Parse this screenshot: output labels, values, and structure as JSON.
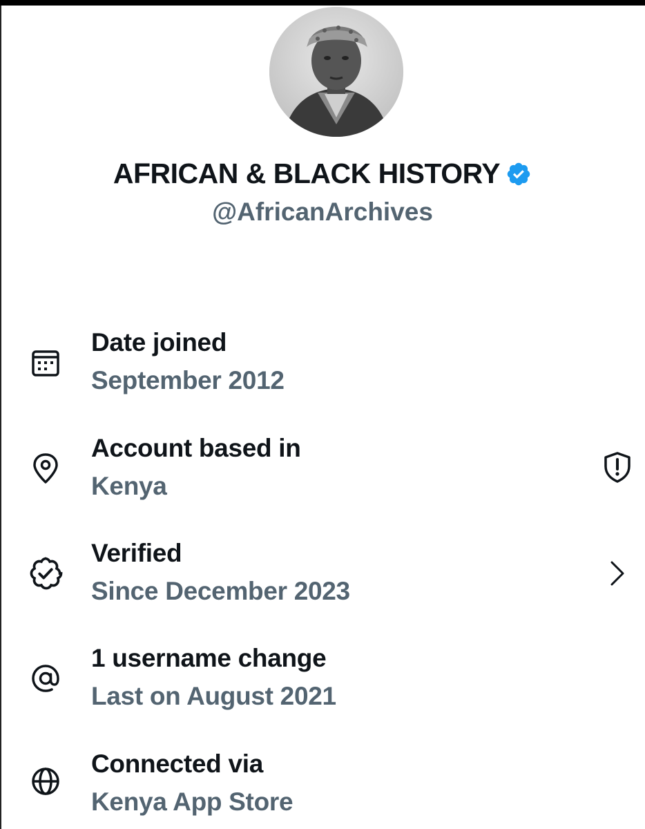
{
  "profile": {
    "display_name": "AFRICAN & BLACK HISTORY",
    "handle": "@AfricanArchives",
    "verified_badge_color": "#1d9bf0",
    "avatar_icon": "profile-photo"
  },
  "about": {
    "items": [
      {
        "icon": "calendar-icon",
        "label": "Date joined",
        "value": "September 2012",
        "action": null
      },
      {
        "icon": "location-pin-icon",
        "label": "Account based in",
        "value": "Kenya",
        "action": "shield-alert-icon"
      },
      {
        "icon": "verified-badge-icon",
        "label": "Verified",
        "value": "Since December 2023",
        "action": "chevron-right-icon"
      },
      {
        "icon": "at-sign-icon",
        "label": "1 username change",
        "value": "Last on August 2021",
        "action": null
      },
      {
        "icon": "globe-icon",
        "label": "Connected via",
        "value": "Kenya App Store",
        "action": null
      }
    ]
  },
  "colors": {
    "primary_text": "#0f1419",
    "secondary_text": "#536471",
    "background": "#ffffff"
  }
}
